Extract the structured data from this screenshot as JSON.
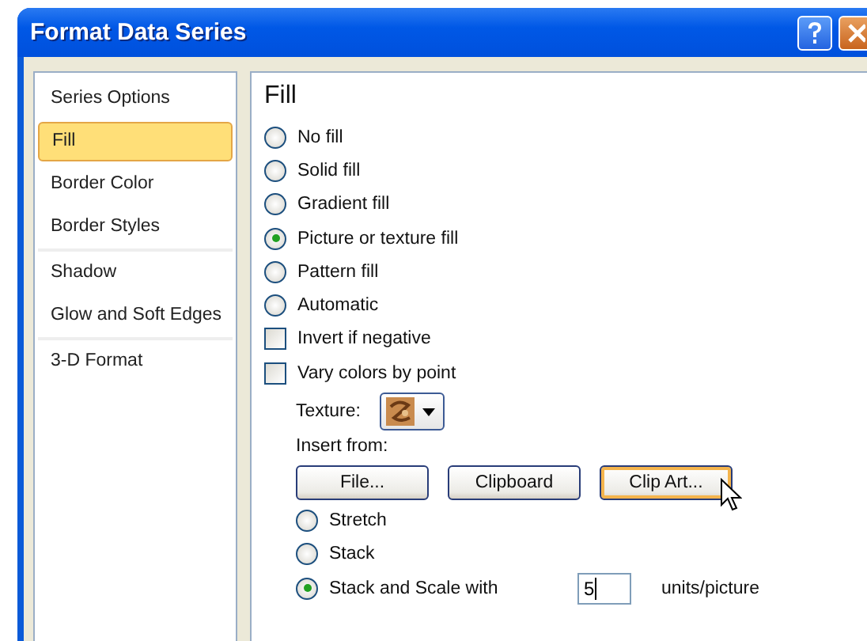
{
  "window": {
    "title": "Format Data Series"
  },
  "sidebar": {
    "items": [
      {
        "label": "Series Options",
        "selected": false,
        "divider_after": false
      },
      {
        "label": "Fill",
        "selected": true,
        "divider_after": false
      },
      {
        "label": "Border Color",
        "selected": false,
        "divider_after": false
      },
      {
        "label": "Border Styles",
        "selected": false,
        "divider_after": true
      },
      {
        "label": "Shadow",
        "selected": false,
        "divider_after": false
      },
      {
        "label": "Glow and Soft Edges",
        "selected": false,
        "divider_after": true
      },
      {
        "label": "3-D Format",
        "selected": false,
        "divider_after": false
      }
    ]
  },
  "panel": {
    "heading": "Fill",
    "options": [
      {
        "kind": "radio",
        "label": "No fill",
        "selected": false
      },
      {
        "kind": "radio",
        "label": "Solid fill",
        "selected": false
      },
      {
        "kind": "radio",
        "label": "Gradient fill",
        "selected": false
      },
      {
        "kind": "radio",
        "label": "Picture or texture fill",
        "selected": true
      },
      {
        "kind": "radio",
        "label": "Pattern fill",
        "selected": false
      },
      {
        "kind": "radio",
        "label": "Automatic",
        "selected": false
      },
      {
        "kind": "checkbox",
        "label": "Invert if negative",
        "checked": false
      },
      {
        "kind": "checkbox",
        "label": "Vary colors by point",
        "checked": false
      }
    ],
    "texture": {
      "label": "Texture:"
    },
    "insert_from": {
      "label": "Insert from:",
      "buttons": [
        {
          "label": "File...",
          "hovered": false
        },
        {
          "label": "Clipboard",
          "hovered": false
        },
        {
          "label": "Clip Art...",
          "hovered": true
        }
      ]
    },
    "tiling": [
      {
        "label": "Stretch",
        "selected": false
      },
      {
        "label": "Stack",
        "selected": false
      },
      {
        "label": "Stack and Scale with",
        "selected": true,
        "value": "5",
        "unit": "units/picture"
      }
    ]
  }
}
